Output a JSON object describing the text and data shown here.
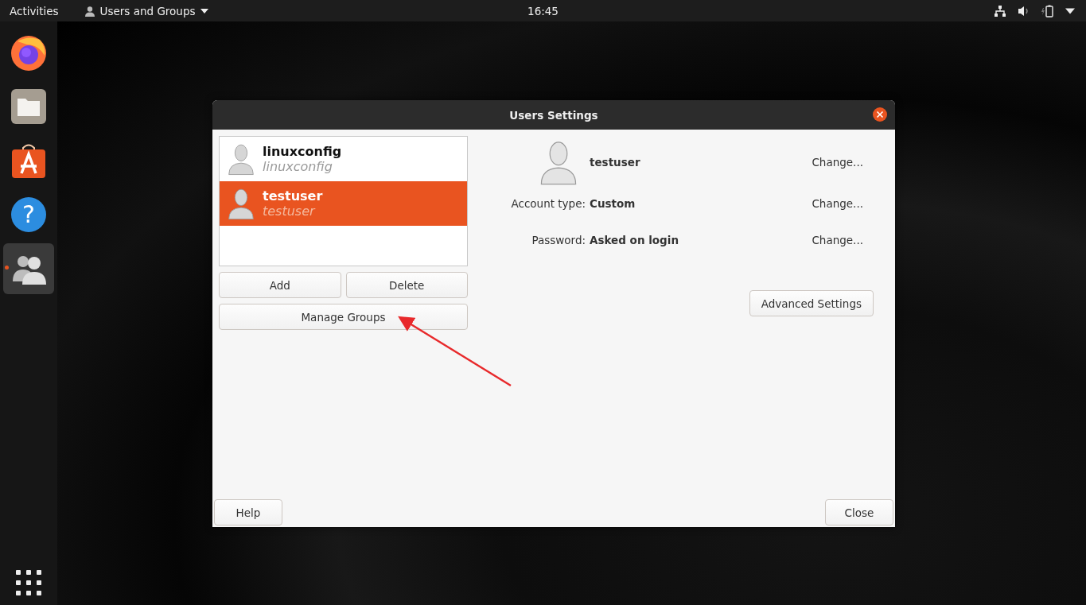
{
  "top_bar": {
    "activities": "Activities",
    "app_menu": "Users and Groups",
    "clock": "16:45"
  },
  "dock": {
    "items": [
      {
        "kind": "browser",
        "running": false,
        "selected": false
      },
      {
        "kind": "files",
        "running": false,
        "selected": false
      },
      {
        "kind": "software",
        "running": false,
        "selected": false
      },
      {
        "kind": "help",
        "glyph": "?",
        "running": false,
        "selected": false
      },
      {
        "kind": "users",
        "running": true,
        "selected": true
      }
    ]
  },
  "dialog": {
    "title": "Users Settings",
    "users": [
      {
        "name": "linuxconfig",
        "login": "linuxconfig",
        "selected": false
      },
      {
        "name": "testuser",
        "login": "testuser",
        "selected": true
      }
    ],
    "add_button": "Add",
    "delete_button": "Delete",
    "manage_groups_button": "Manage Groups",
    "user_name": "testuser",
    "fields": [
      {
        "label": "Account type:",
        "value": "Custom",
        "action": "Change..."
      },
      {
        "label": "Password:",
        "value": "Asked on login",
        "action": "Change..."
      }
    ],
    "name_action": "Change...",
    "advanced_button": "Advanced Settings",
    "help_button": "Help",
    "close_button": "Close"
  }
}
